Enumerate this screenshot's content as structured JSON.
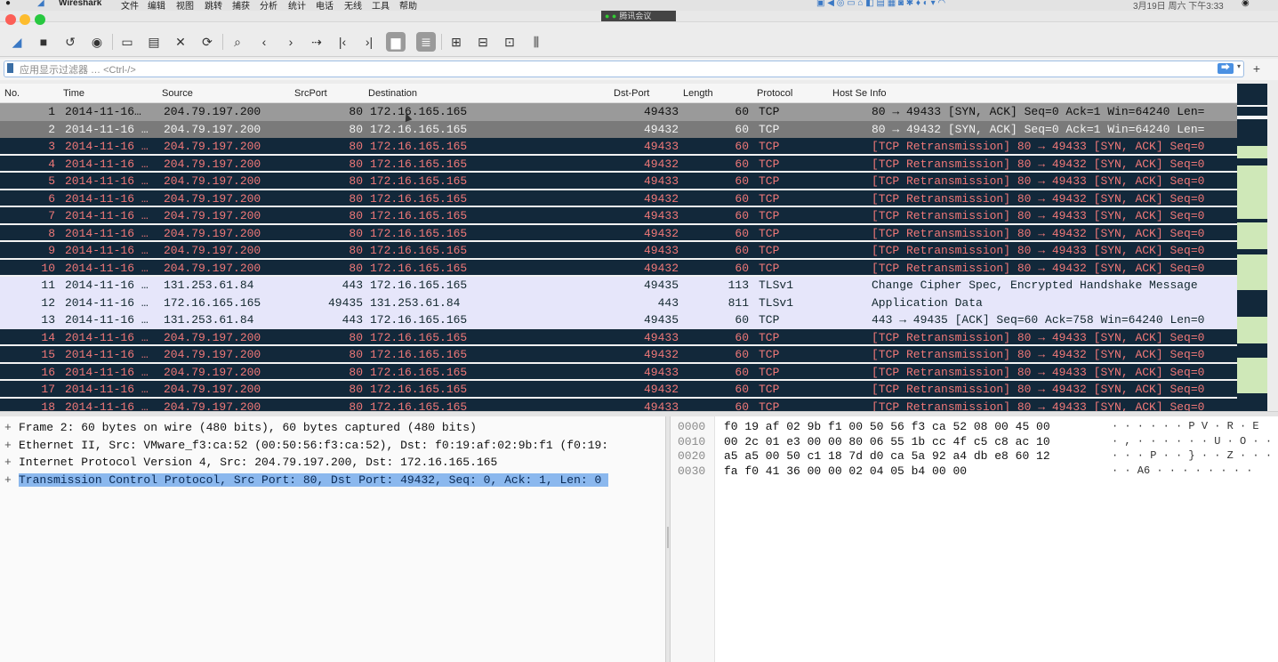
{
  "menubar": {
    "app": "Wireshark",
    "items": [
      "文件",
      "编辑",
      "视图",
      "跳转",
      "捕获",
      "分析",
      "统计",
      "电话",
      "无线",
      "工具",
      "帮助"
    ],
    "clock": "3月19日 周六 下午3:33"
  },
  "meeting_banner": "腾讯会议",
  "toolbar": {
    "buttons": [
      {
        "name": "start-capture-icon",
        "glyph": "◢"
      },
      {
        "name": "stop-capture-icon",
        "glyph": "■"
      },
      {
        "name": "restart-capture-icon",
        "glyph": "↺"
      },
      {
        "name": "capture-options-icon",
        "glyph": "◉"
      },
      {
        "name": "open-file-icon",
        "glyph": "▭"
      },
      {
        "name": "save-file-icon",
        "glyph": "▤"
      },
      {
        "name": "close-file-icon",
        "glyph": "✕"
      },
      {
        "name": "reload-file-icon",
        "glyph": "⟳"
      },
      {
        "name": "find-packet-icon",
        "glyph": "⌕"
      },
      {
        "name": "go-back-icon",
        "glyph": "‹"
      },
      {
        "name": "go-forward-icon",
        "glyph": "›"
      },
      {
        "name": "go-to-packet-icon",
        "glyph": "⇢"
      },
      {
        "name": "first-packet-icon",
        "glyph": "|‹"
      },
      {
        "name": "last-packet-icon",
        "glyph": "›|"
      },
      {
        "name": "autoscroll-icon",
        "glyph": "▆"
      },
      {
        "name": "colorize-icon",
        "glyph": "≣"
      },
      {
        "name": "zoom-in-icon",
        "glyph": "⊞"
      },
      {
        "name": "zoom-out-icon",
        "glyph": "⊟"
      },
      {
        "name": "normal-size-icon",
        "glyph": "⊡"
      },
      {
        "name": "resize-columns-icon",
        "glyph": "⫼"
      }
    ]
  },
  "filter": {
    "placeholder": "应用显示过滤器 … <Ctrl-/>",
    "apply_label": "⮕",
    "add_label": "+"
  },
  "packet_list": {
    "columns": [
      "No.",
      "Time",
      "Source",
      "SrcPort",
      "Destination",
      "Dst-Port",
      "Length",
      "Protocol",
      "Host Se Info"
    ],
    "rows": [
      {
        "no": "1",
        "time": "2014-11-16…",
        "src": "204.79.197.200",
        "sport": "80",
        "dst": "172.16.165.165",
        "dport": "49433",
        "len": "60",
        "proto": "TCP",
        "info": "80 → 49433 [SYN, ACK] Seq=0 Ack=1 Win=64240 Len=",
        "style": "sel1"
      },
      {
        "no": "2",
        "time": "2014-11-16 …",
        "src": "204.79.197.200",
        "sport": "80",
        "dst": "172.16.165.165",
        "dport": "49432",
        "len": "60",
        "proto": "TCP",
        "info": "80 → 49432 [SYN, ACK] Seq=0 Ack=1 Win=64240 Len=",
        "style": "sel2"
      },
      {
        "no": "3",
        "time": "2014-11-16 …",
        "src": "204.79.197.200",
        "sport": "80",
        "dst": "172.16.165.165",
        "dport": "49433",
        "len": "60",
        "proto": "TCP",
        "info": "[TCP Retransmission] 80 → 49433 [SYN, ACK] Seq=0",
        "style": "retrans"
      },
      {
        "no": "4",
        "time": "2014-11-16 …",
        "src": "204.79.197.200",
        "sport": "80",
        "dst": "172.16.165.165",
        "dport": "49432",
        "len": "60",
        "proto": "TCP",
        "info": "[TCP Retransmission] 80 → 49432 [SYN, ACK] Seq=0",
        "style": "retrans"
      },
      {
        "no": "5",
        "time": "2014-11-16 …",
        "src": "204.79.197.200",
        "sport": "80",
        "dst": "172.16.165.165",
        "dport": "49433",
        "len": "60",
        "proto": "TCP",
        "info": "[TCP Retransmission] 80 → 49433 [SYN, ACK] Seq=0",
        "style": "retrans"
      },
      {
        "no": "6",
        "time": "2014-11-16 …",
        "src": "204.79.197.200",
        "sport": "80",
        "dst": "172.16.165.165",
        "dport": "49432",
        "len": "60",
        "proto": "TCP",
        "info": "[TCP Retransmission] 80 → 49432 [SYN, ACK] Seq=0",
        "style": "retrans"
      },
      {
        "no": "7",
        "time": "2014-11-16 …",
        "src": "204.79.197.200",
        "sport": "80",
        "dst": "172.16.165.165",
        "dport": "49433",
        "len": "60",
        "proto": "TCP",
        "info": "[TCP Retransmission] 80 → 49433 [SYN, ACK] Seq=0",
        "style": "retrans"
      },
      {
        "no": "8",
        "time": "2014-11-16 …",
        "src": "204.79.197.200",
        "sport": "80",
        "dst": "172.16.165.165",
        "dport": "49432",
        "len": "60",
        "proto": "TCP",
        "info": "[TCP Retransmission] 80 → 49432 [SYN, ACK] Seq=0",
        "style": "retrans"
      },
      {
        "no": "9",
        "time": "2014-11-16 …",
        "src": "204.79.197.200",
        "sport": "80",
        "dst": "172.16.165.165",
        "dport": "49433",
        "len": "60",
        "proto": "TCP",
        "info": "[TCP Retransmission] 80 → 49433 [SYN, ACK] Seq=0",
        "style": "retrans"
      },
      {
        "no": "10",
        "time": "2014-11-16 …",
        "src": "204.79.197.200",
        "sport": "80",
        "dst": "172.16.165.165",
        "dport": "49432",
        "len": "60",
        "proto": "TCP",
        "info": "[TCP Retransmission] 80 → 49432 [SYN, ACK] Seq=0",
        "style": "retrans"
      },
      {
        "no": "11",
        "time": "2014-11-16 …",
        "src": "131.253.61.84",
        "sport": "443",
        "dst": "172.16.165.165",
        "dport": "49435",
        "len": "113",
        "proto": "TLSv1",
        "info": "Change Cipher Spec, Encrypted Handshake Message",
        "style": "tls"
      },
      {
        "no": "12",
        "time": "2014-11-16 …",
        "src": "172.16.165.165",
        "sport": "49435",
        "dst": "131.253.61.84",
        "dport": "443",
        "len": "811",
        "proto": "TLSv1",
        "info": "Application Data",
        "style": "tls"
      },
      {
        "no": "13",
        "time": "2014-11-16 …",
        "src": "131.253.61.84",
        "sport": "443",
        "dst": "172.16.165.165",
        "dport": "49435",
        "len": "60",
        "proto": "TCP",
        "info": "443 → 49435 [ACK] Seq=60 Ack=758 Win=64240 Len=0",
        "style": "tls"
      },
      {
        "no": "14",
        "time": "2014-11-16 …",
        "src": "204.79.197.200",
        "sport": "80",
        "dst": "172.16.165.165",
        "dport": "49433",
        "len": "60",
        "proto": "TCP",
        "info": "[TCP Retransmission] 80 → 49433 [SYN, ACK] Seq=0",
        "style": "retrans"
      },
      {
        "no": "15",
        "time": "2014-11-16 …",
        "src": "204.79.197.200",
        "sport": "80",
        "dst": "172.16.165.165",
        "dport": "49432",
        "len": "60",
        "proto": "TCP",
        "info": "[TCP Retransmission] 80 → 49432 [SYN, ACK] Seq=0",
        "style": "retrans"
      },
      {
        "no": "16",
        "time": "2014-11-16 …",
        "src": "204.79.197.200",
        "sport": "80",
        "dst": "172.16.165.165",
        "dport": "49433",
        "len": "60",
        "proto": "TCP",
        "info": "[TCP Retransmission] 80 → 49433 [SYN, ACK] Seq=0",
        "style": "retrans"
      },
      {
        "no": "17",
        "time": "2014-11-16 …",
        "src": "204.79.197.200",
        "sport": "80",
        "dst": "172.16.165.165",
        "dport": "49432",
        "len": "60",
        "proto": "TCP",
        "info": "[TCP Retransmission] 80 → 49432 [SYN, ACK] Seq=0",
        "style": "retrans"
      },
      {
        "no": "18",
        "time": "2014-11-16 …",
        "src": "204.79.197.200",
        "sport": "80",
        "dst": "172.16.165.165",
        "dport": "49433",
        "len": "60",
        "proto": "TCP",
        "info": "[TCP Retransmission] 80 → 49433 [SYN, ACK] Seq=0",
        "style": "retrans"
      }
    ]
  },
  "details": {
    "rows": [
      {
        "toggle": "+",
        "text": "Frame 2: 60 bytes on wire (480 bits), 60 bytes captured (480 bits)",
        "highlight": false
      },
      {
        "toggle": "+",
        "text": "Ethernet II, Src: VMware_f3:ca:52 (00:50:56:f3:ca:52), Dst: f0:19:af:02:9b:f1 (f0:19:",
        "highlight": false
      },
      {
        "toggle": "+",
        "text": "Internet Protocol Version 4, Src: 204.79.197.200, Dst: 172.16.165.165",
        "highlight": false
      },
      {
        "toggle": "+",
        "text": "Transmission Control Protocol, Src Port: 80, Dst Port: 49432, Seq: 0, Ack: 1, Len: 0",
        "highlight": true
      }
    ]
  },
  "bytes": {
    "rows": [
      {
        "offset": "0000",
        "hex": "f0 19 af 02 9b f1 00 50  56 f3 ca 52 08 00 45 00",
        "ascii": "· · · · · · P V · R · E"
      },
      {
        "offset": "0010",
        "hex": "00 2c 01 e3 00 00 80 06  55 1b cc 4f c5 c8 ac 10",
        "ascii": "· , · · · · · ·  U · O · · · ·"
      },
      {
        "offset": "0020",
        "hex": "a5 a5 00 50 c1 18 7d d0  ca 5a 92 a4 db e8 60 12",
        "ascii": "· · · P · · } ·  · Z · · · · ` ·"
      },
      {
        "offset": "0030",
        "hex": "fa f0 41 36 00 00 02 04  05 b4 00 00",
        "ascii": "· · A6 · · · ·  · · · ·"
      }
    ]
  },
  "colors": {
    "retrans_bg": "#12283a",
    "retrans_fg": "#f07878",
    "tls_bg": "#e6e6fa",
    "selection": "#8bb8ee"
  }
}
